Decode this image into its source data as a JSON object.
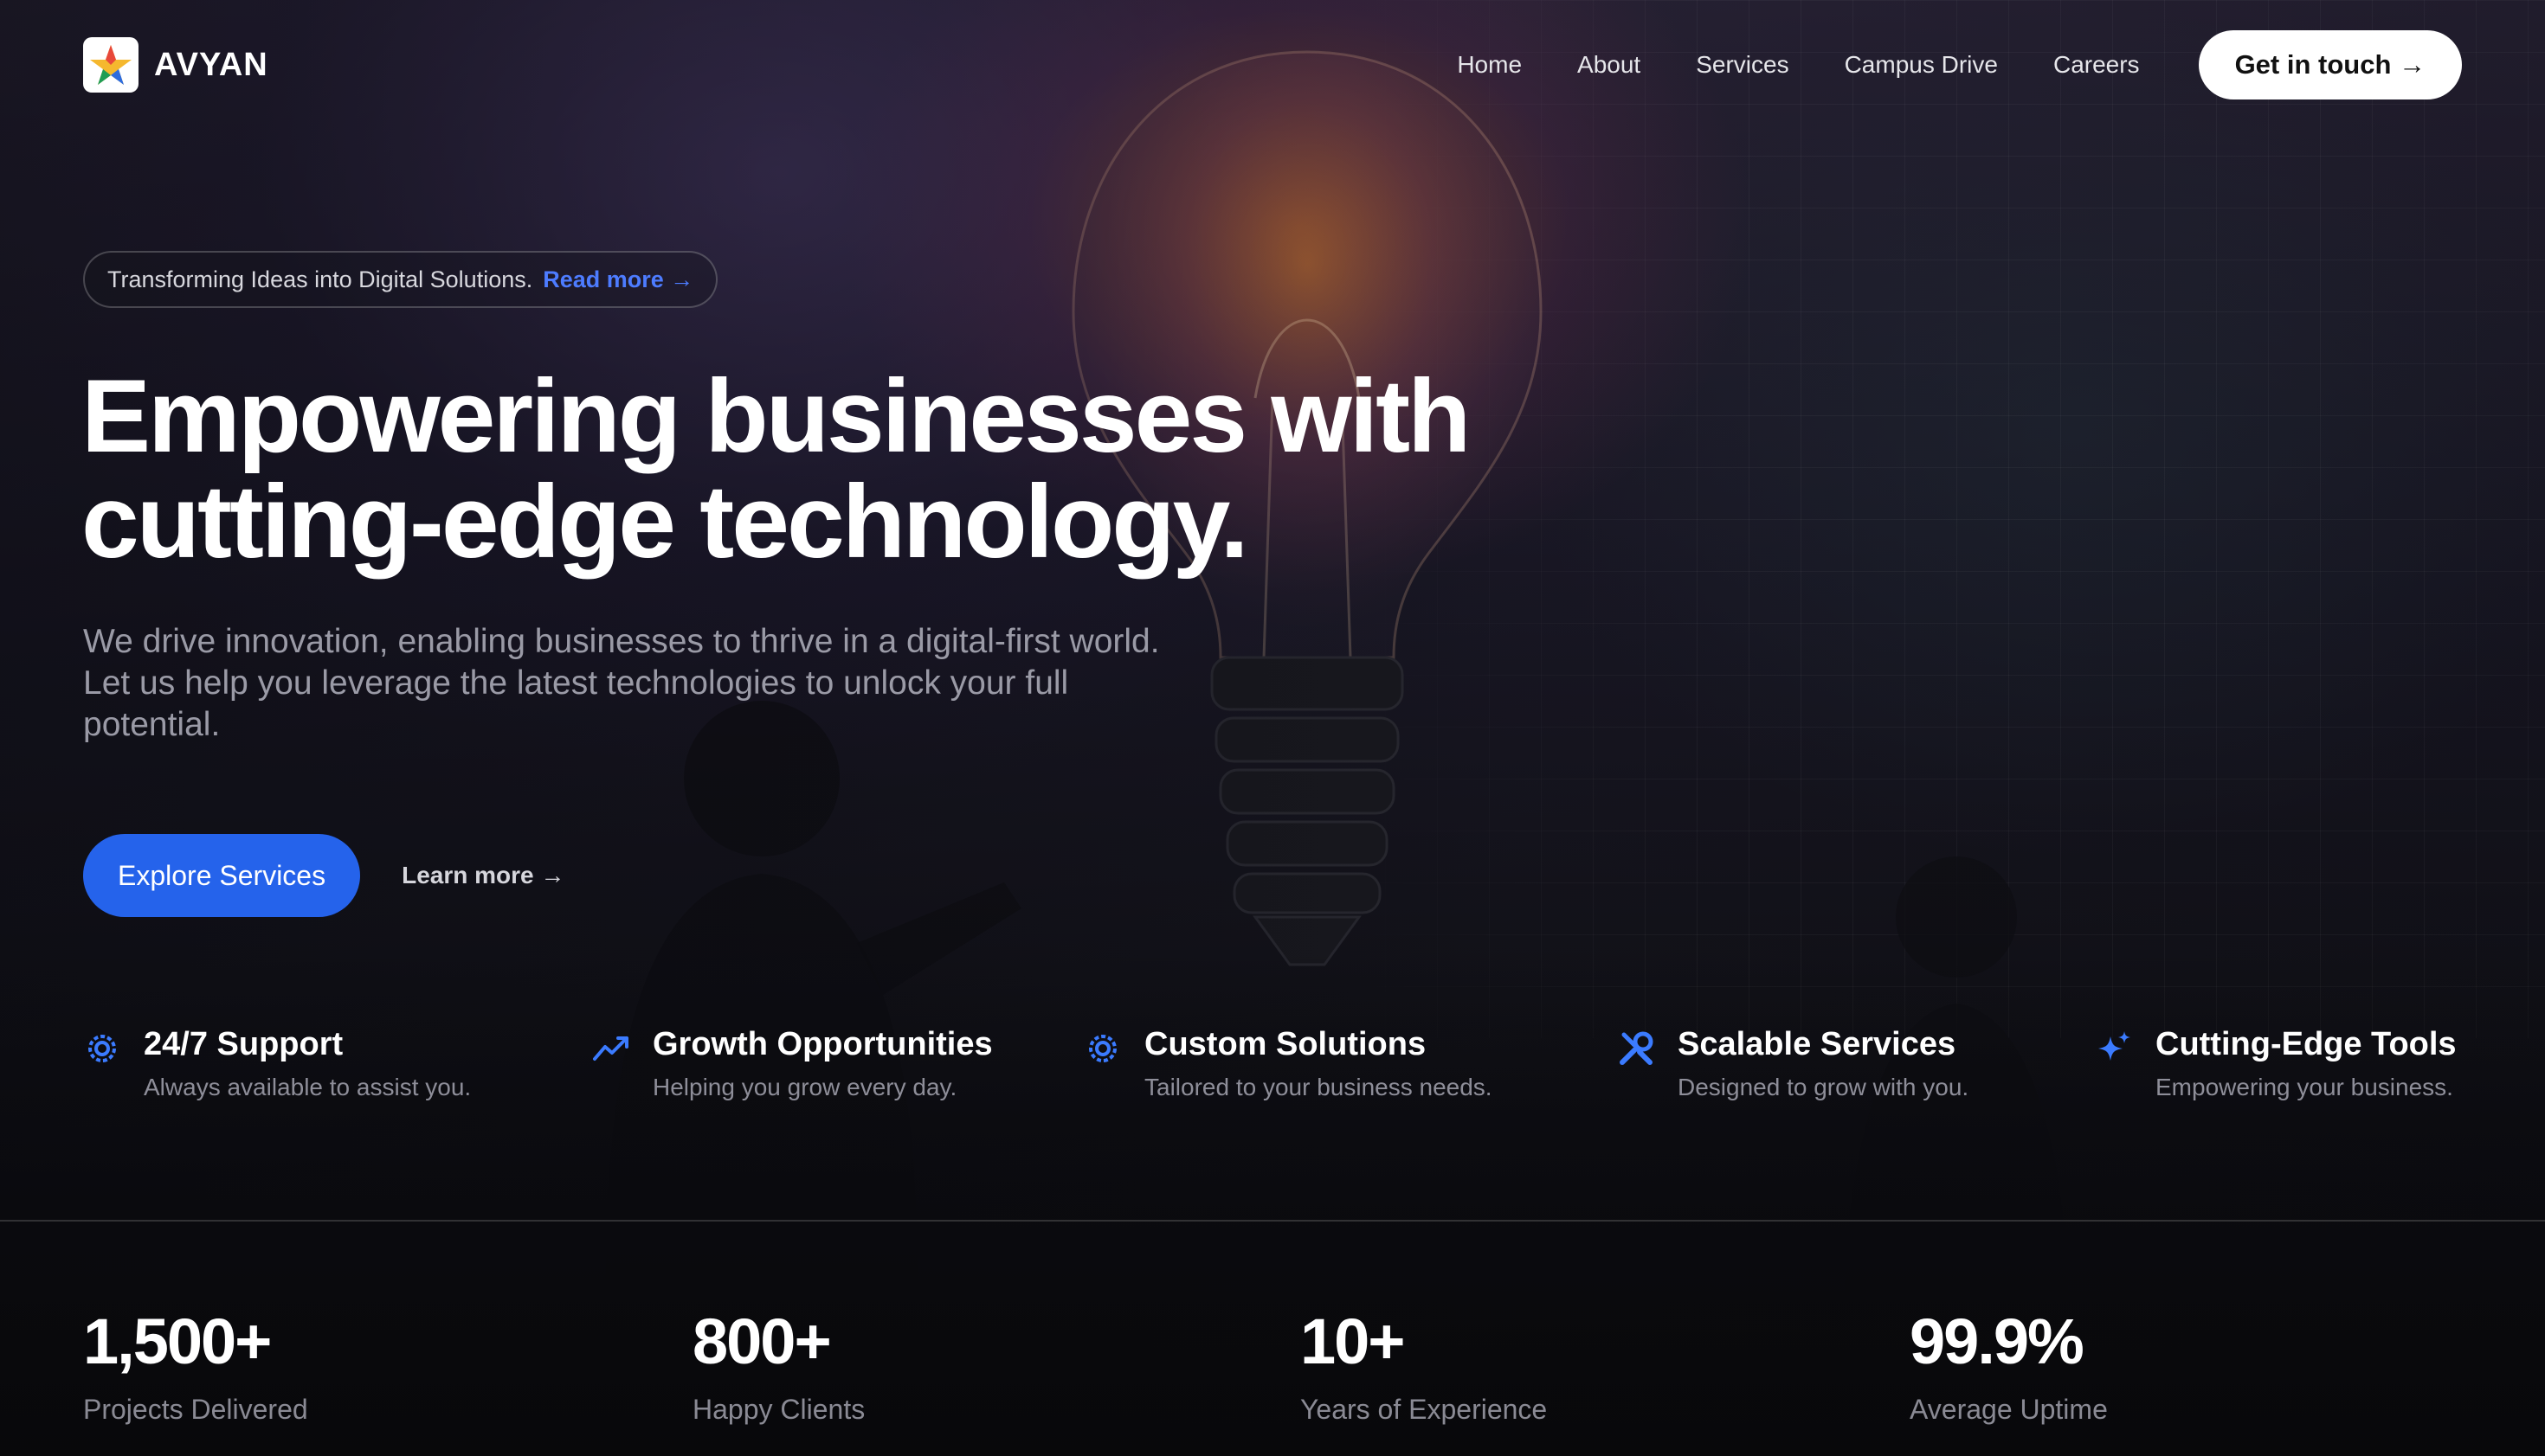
{
  "brand": {
    "name": "AVYAN",
    "logo_icon": "star-logo-icon"
  },
  "nav": {
    "items": [
      {
        "label": "Home"
      },
      {
        "label": "About"
      },
      {
        "label": "Services"
      },
      {
        "label": "Campus Drive"
      },
      {
        "label": "Careers"
      }
    ],
    "cta_label": "Get in touch →"
  },
  "announcement": {
    "text": "Transforming Ideas into Digital Solutions.",
    "link_label": "Read more →",
    "link_color": "#4d7cff"
  },
  "hero": {
    "headline_line1": "Empowering businesses with",
    "headline_line2": "cutting-edge technology.",
    "subtext_line1": "We drive innovation, enabling businesses to thrive in a digital-first world.",
    "subtext_line2": "Let us help you leverage the latest technologies to unlock your full",
    "subtext_line3": "potential.",
    "primary_button": "Explore Services",
    "secondary_link": "Learn more →",
    "accent_color": "#2563eb"
  },
  "features": [
    {
      "icon": "gear-icon",
      "title": "24/7 Support",
      "desc": "Always available to assist you."
    },
    {
      "icon": "trend-up-icon",
      "title": "Growth Opportunities",
      "desc": "Helping you grow every day."
    },
    {
      "icon": "gear-icon",
      "title": "Custom Solutions",
      "desc": "Tailored to your business needs."
    },
    {
      "icon": "wrench-icon",
      "title": "Scalable Services",
      "desc": "Designed to grow with you."
    },
    {
      "icon": "sparkles-icon",
      "title": "Cutting-Edge Tools",
      "desc": "Empowering your business."
    }
  ],
  "stats": [
    {
      "value": "1,500+",
      "label": "Projects Delivered"
    },
    {
      "value": "800+",
      "label": "Happy Clients"
    },
    {
      "value": "10+",
      "label": "Years of Experience"
    },
    {
      "value": "99.9%",
      "label": "Average Uptime"
    }
  ]
}
